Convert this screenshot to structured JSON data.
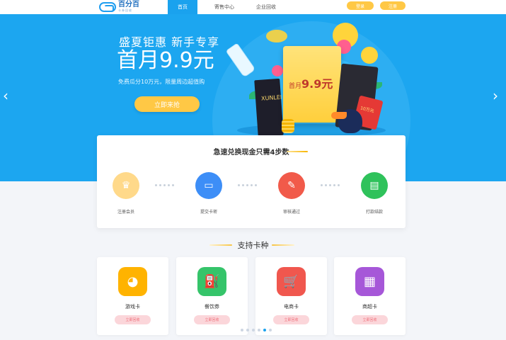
{
  "colors": {
    "brand": "#1aa2ee",
    "accent": "#ffc845",
    "banner_bg": "#1ca6f0"
  },
  "logo": {
    "name": "百分百",
    "sub": "卡券回收",
    "icon": "logo-mark-icon"
  },
  "nav": {
    "tabs": [
      {
        "label": "首页",
        "active": true
      },
      {
        "label": "寄售中心",
        "active": false
      },
      {
        "label": "企业回收",
        "active": false
      }
    ],
    "login_label": "登录",
    "register_label": "注册"
  },
  "banner": {
    "line1": "盛夏钜惠   新手专享",
    "headline": "首月9.9元",
    "subtext": "免费瓜分10万元，限量周边超值购",
    "cta_label": "立即来抢",
    "envelope_prefix": "首月",
    "envelope_price": "9.9元",
    "dark_card_text": "XUNLEI",
    "redpacket_text": "10万元",
    "prev_icon": "chevron-left-icon",
    "next_icon": "chevron-right-icon"
  },
  "steps": {
    "title": "急速兑换现金只需4步数",
    "items": [
      {
        "label": "注册会员",
        "icon": "crown-icon",
        "color": "#ffd98a"
      },
      {
        "label": "提交卡密",
        "icon": "card-icon",
        "color": "#3d8ef7"
      },
      {
        "label": "审核通过",
        "icon": "pen-icon",
        "color": "#f15a4a"
      },
      {
        "label": "打款结款",
        "icon": "wallet-icon",
        "color": "#2fc25b"
      }
    ]
  },
  "support": {
    "title": "支持卡种",
    "cards": [
      {
        "label": "游戏卡",
        "button": "立即回收",
        "icon": "game-icon",
        "color": "#ffb300"
      },
      {
        "label": "餐饮券",
        "button": "立即回收",
        "icon": "fuel-icon",
        "color": "#35c46a"
      },
      {
        "label": "电商卡",
        "button": "立即回收",
        "icon": "cart-icon",
        "color": "#f0574e"
      },
      {
        "label": "商超卡",
        "button": "立即回收",
        "icon": "store-icon",
        "color": "#a657d8"
      }
    ],
    "pager_count": 6,
    "pager_active_index": 4
  }
}
